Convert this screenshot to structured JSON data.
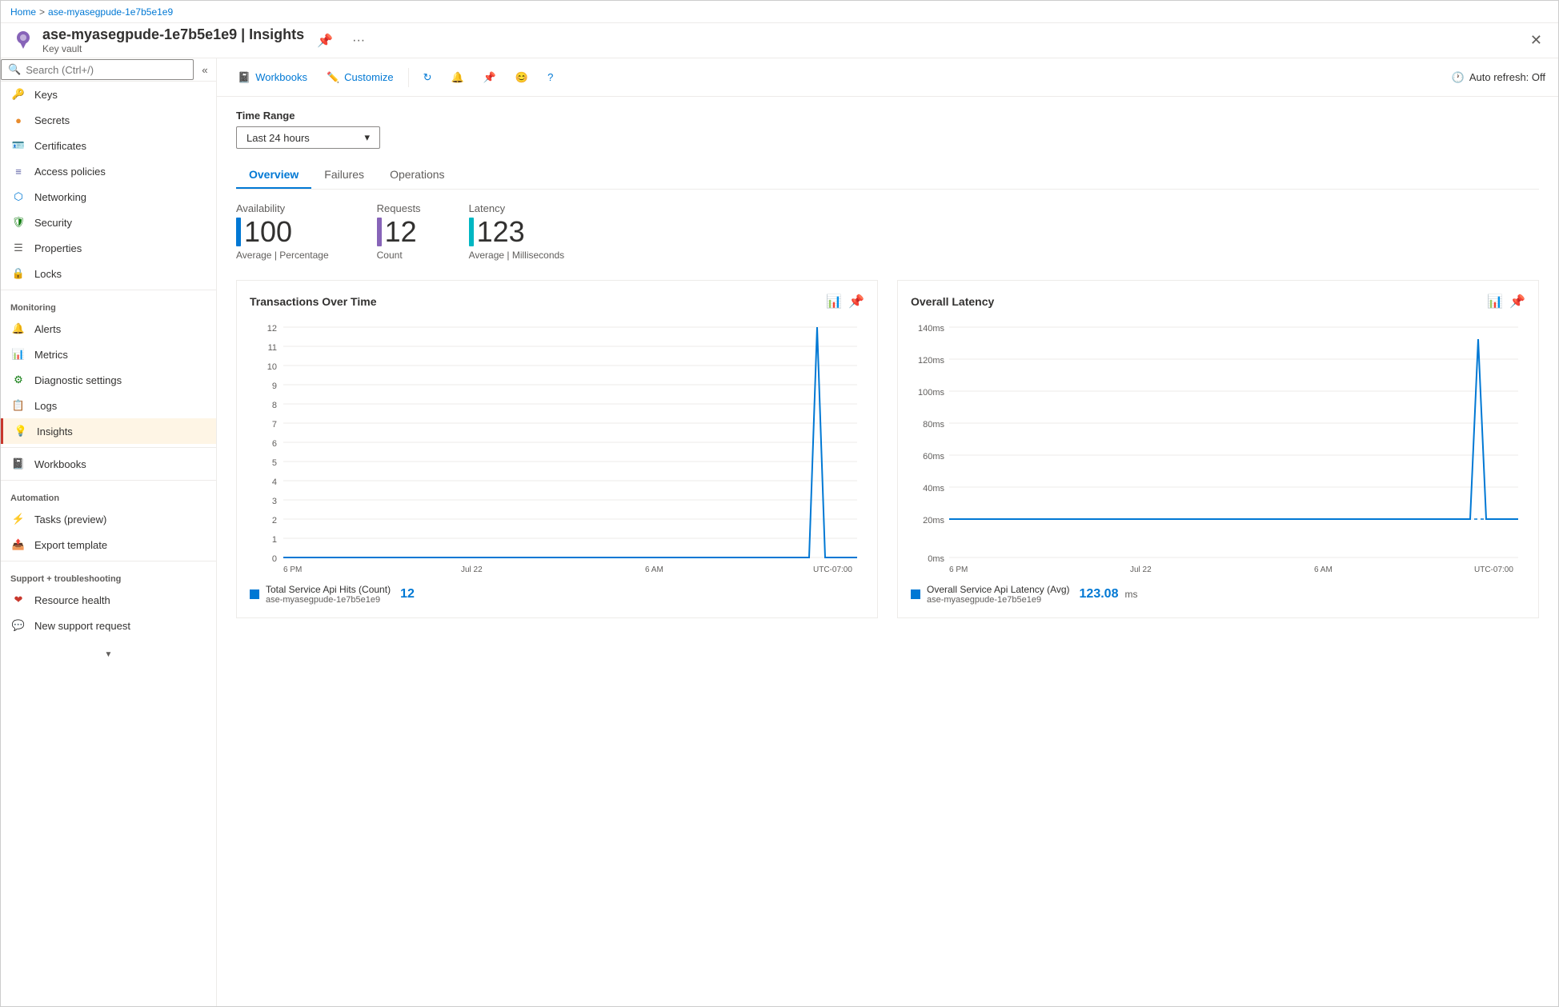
{
  "window": {
    "title": "ase-myasegpude-1e7b5e1e9 | Insights",
    "subtitle": "Key vault",
    "close_label": "✕"
  },
  "breadcrumb": {
    "home": "Home",
    "separator": ">",
    "current": "ase-myasegpude-1e7b5e1e9"
  },
  "sidebar": {
    "search_placeholder": "Search (Ctrl+/)",
    "items_top": [
      {
        "id": "keys",
        "label": "Keys",
        "icon": "🔑"
      },
      {
        "id": "secrets",
        "label": "Secrets",
        "icon": "🟠"
      },
      {
        "id": "certificates",
        "label": "Certificates",
        "icon": "📄"
      },
      {
        "id": "access-policies",
        "label": "Access policies",
        "icon": "≡"
      },
      {
        "id": "networking",
        "label": "Networking",
        "icon": "⬡"
      },
      {
        "id": "security",
        "label": "Security",
        "icon": "🛡"
      },
      {
        "id": "properties",
        "label": "Properties",
        "icon": "☰"
      },
      {
        "id": "locks",
        "label": "Locks",
        "icon": "🔒"
      }
    ],
    "monitoring_label": "Monitoring",
    "items_monitoring": [
      {
        "id": "alerts",
        "label": "Alerts",
        "icon": "🔔"
      },
      {
        "id": "metrics",
        "label": "Metrics",
        "icon": "📊"
      },
      {
        "id": "diagnostic-settings",
        "label": "Diagnostic settings",
        "icon": "⚙"
      },
      {
        "id": "logs",
        "label": "Logs",
        "icon": "📋"
      },
      {
        "id": "insights",
        "label": "Insights",
        "icon": "💡",
        "active": true
      }
    ],
    "workbooks_label": "",
    "items_workbooks": [
      {
        "id": "workbooks",
        "label": "Workbooks",
        "icon": "📓"
      }
    ],
    "automation_label": "Automation",
    "items_automation": [
      {
        "id": "tasks",
        "label": "Tasks (preview)",
        "icon": "⚡"
      },
      {
        "id": "export-template",
        "label": "Export template",
        "icon": "📤"
      }
    ],
    "support_label": "Support + troubleshooting",
    "items_support": [
      {
        "id": "resource-health",
        "label": "Resource health",
        "icon": "❤"
      },
      {
        "id": "new-support",
        "label": "New support request",
        "icon": "💬"
      }
    ]
  },
  "toolbar": {
    "workbooks_label": "Workbooks",
    "customize_label": "Customize",
    "auto_refresh_label": "Auto refresh: Off"
  },
  "content": {
    "time_range_label": "Time Range",
    "time_range_value": "Last 24 hours",
    "tabs": [
      {
        "id": "overview",
        "label": "Overview",
        "active": true
      },
      {
        "id": "failures",
        "label": "Failures",
        "active": false
      },
      {
        "id": "operations",
        "label": "Operations",
        "active": false
      }
    ],
    "metrics": [
      {
        "label": "Availability",
        "value": "100",
        "sublabel": "Average | Percentage",
        "bar_color": "#0078d4"
      },
      {
        "label": "Requests",
        "value": "12",
        "sublabel": "Count",
        "bar_color": "#8764b8"
      },
      {
        "label": "Latency",
        "value": "123",
        "sublabel": "Average | Milliseconds",
        "bar_color": "#00b7c3"
      }
    ],
    "charts": [
      {
        "id": "transactions",
        "title": "Transactions Over Time",
        "y_labels": [
          "12",
          "11",
          "10",
          "9",
          "8",
          "7",
          "6",
          "5",
          "4",
          "3",
          "2",
          "1",
          "0"
        ],
        "x_labels": [
          "6 PM",
          "",
          "Jul 22",
          "",
          "6 AM",
          "",
          "UTC-07:00"
        ],
        "legend_color": "#0078d4",
        "legend_text": "Total Service Api Hits (Count)",
        "legend_sub": "ase-myasegpude-1e7b5e1e9",
        "legend_value": "12"
      },
      {
        "id": "latency",
        "title": "Overall Latency",
        "y_labels": [
          "140ms",
          "120ms",
          "100ms",
          "80ms",
          "60ms",
          "40ms",
          "20ms",
          "0ms"
        ],
        "x_labels": [
          "6 PM",
          "",
          "Jul 22",
          "",
          "6 AM",
          "",
          "UTC-07:00"
        ],
        "legend_color": "#0078d4",
        "legend_text": "Overall Service Api Latency (Avg)",
        "legend_sub": "ase-myasegpude-1e7b5e1e9",
        "legend_value": "123.08",
        "legend_unit": "ms"
      }
    ]
  }
}
